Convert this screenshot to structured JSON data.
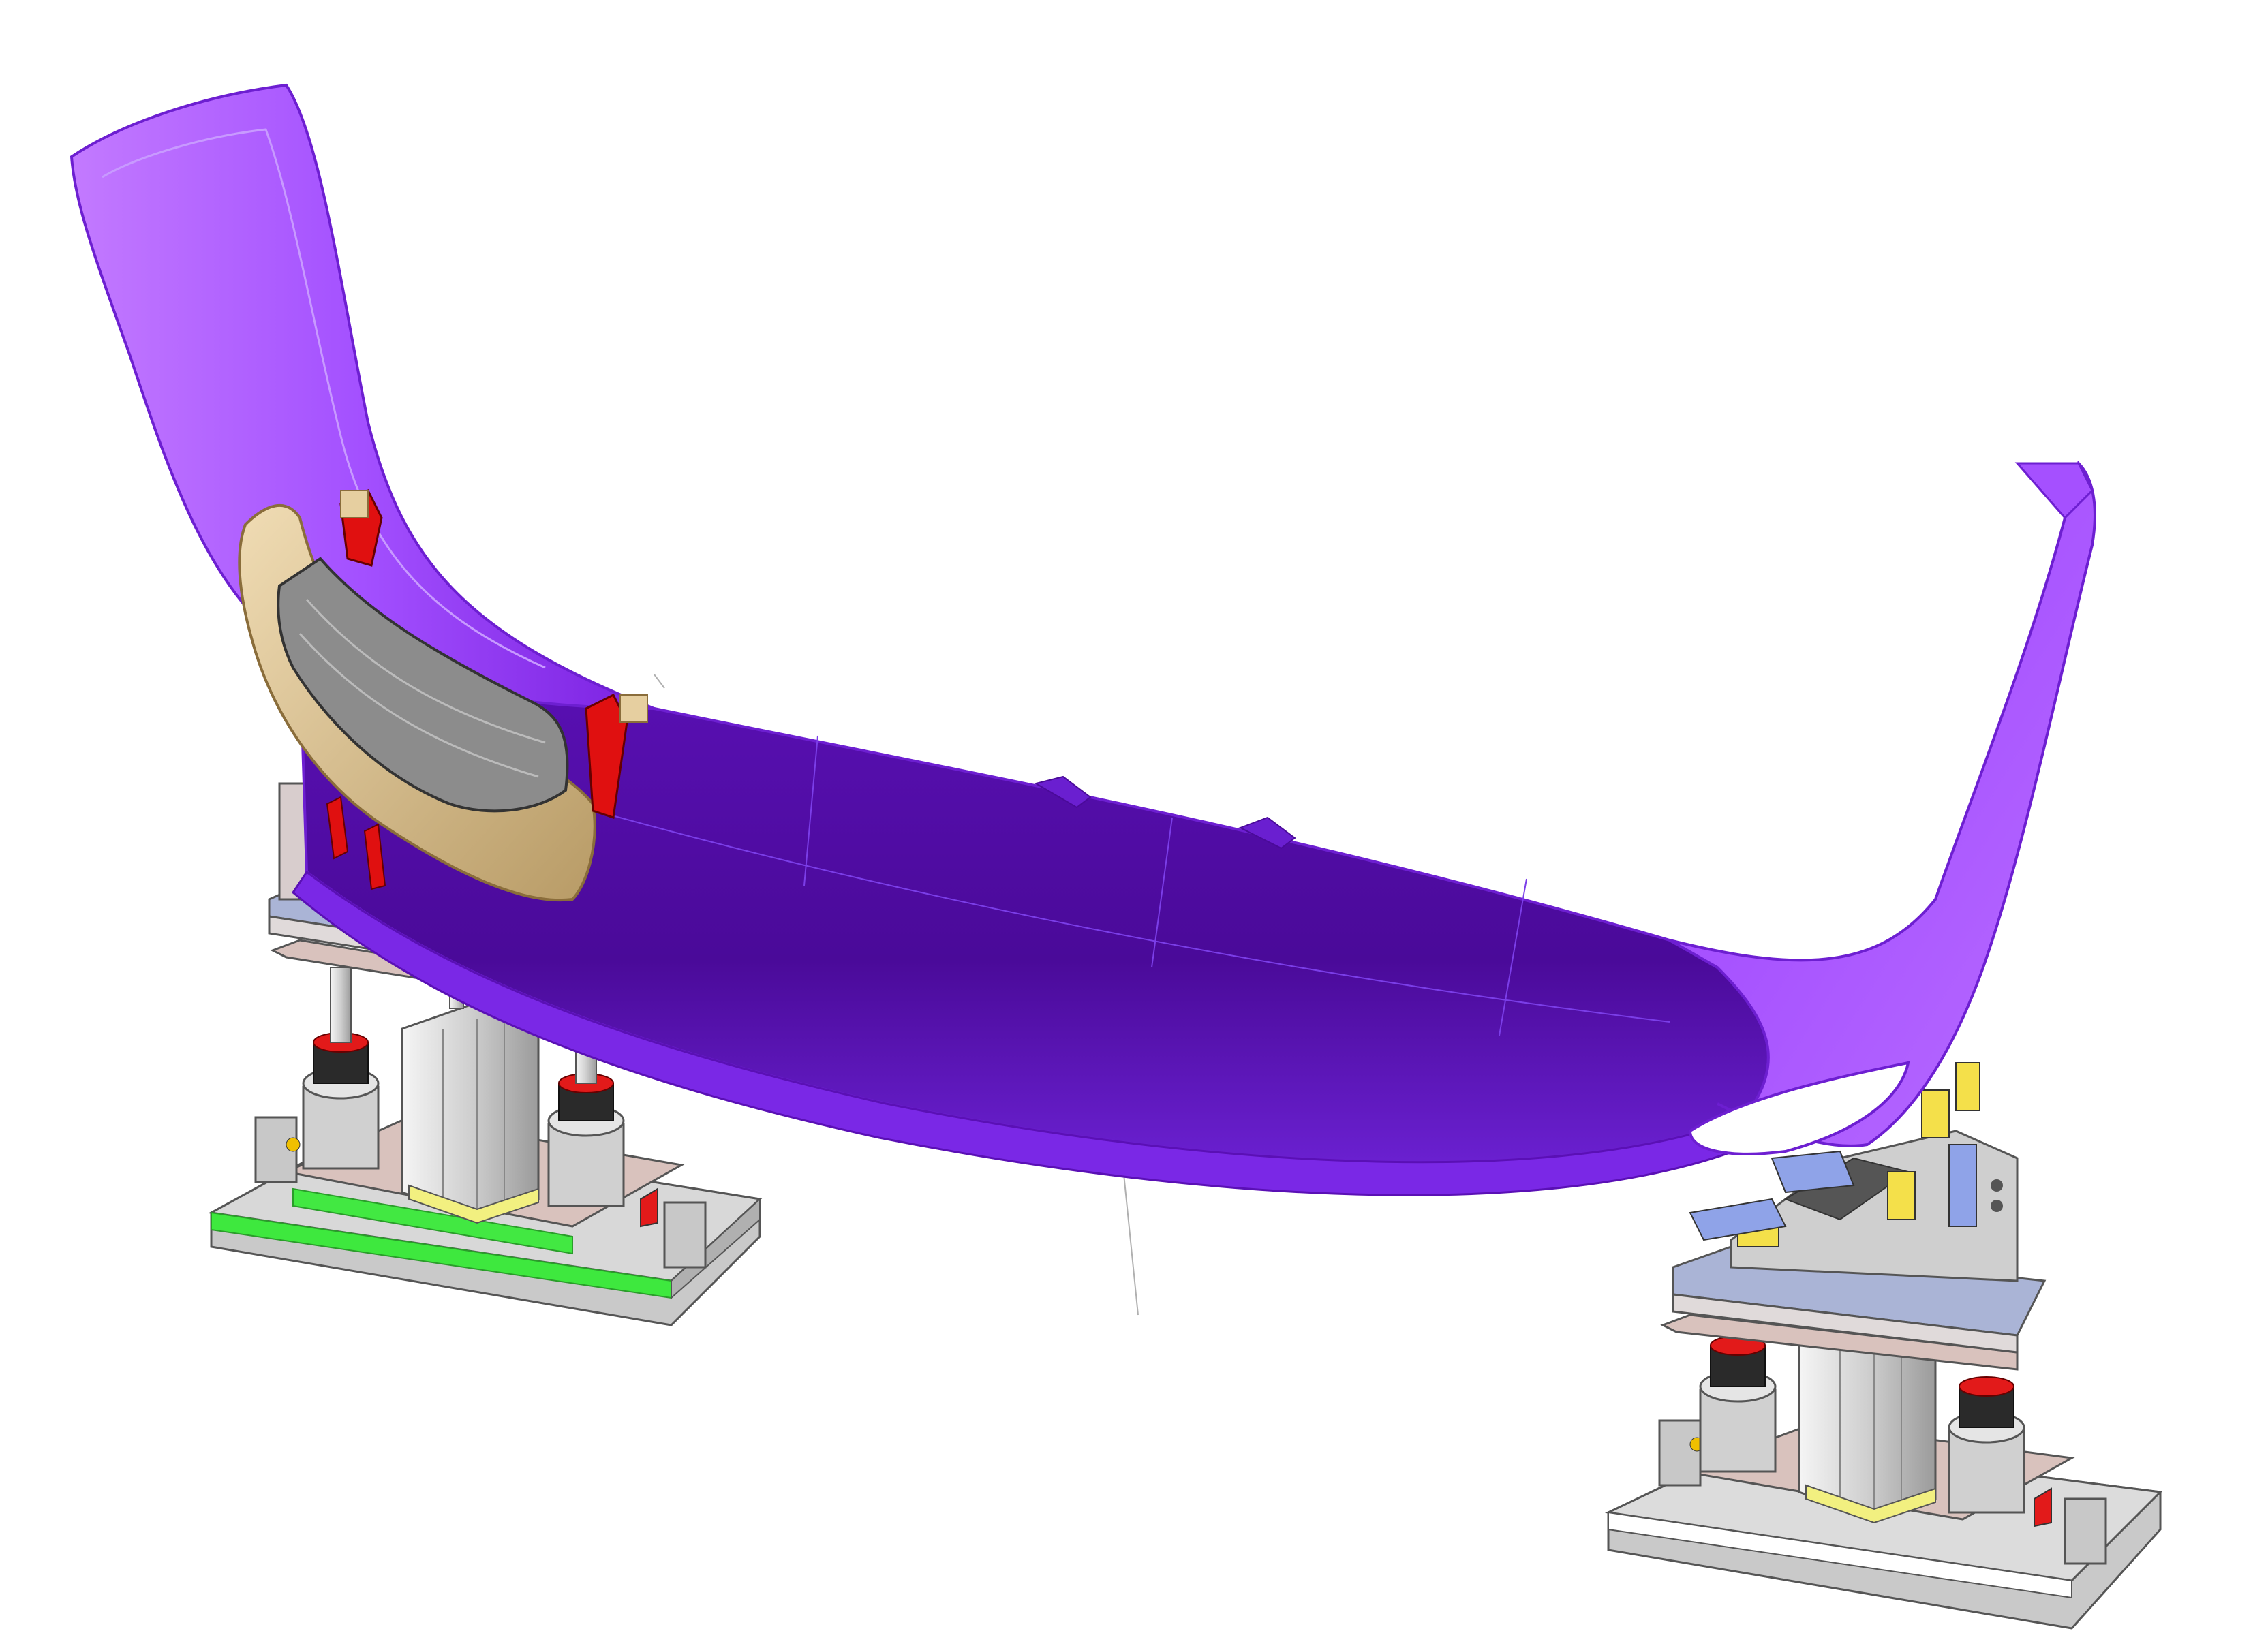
{
  "scene": {
    "subject": "",
    "colors": {
      "background": "#ffffff",
      "bumper_light": "#b36bff",
      "bumper_mid": "#8a2be2",
      "bumper_dark": "#4a0a99",
      "bumper_edge": "#6d1fd1",
      "bracket_tan": "#d8bf8f",
      "bracket_gray": "#8c8c8c",
      "clip_red": "#e01010",
      "base_gray": "#bdbdbd",
      "base_dark": "#8a8a8a",
      "plate_pink": "#d9c2bd",
      "plate_blue": "#aab4d6",
      "green_strip": "#39e639",
      "yellow_pad": "#f2f080",
      "cylinder": "#d8d8d8",
      "black_ring": "#222222",
      "blue_pad": "#8fa3e8",
      "yellow_label": "#f4e04a"
    }
  }
}
